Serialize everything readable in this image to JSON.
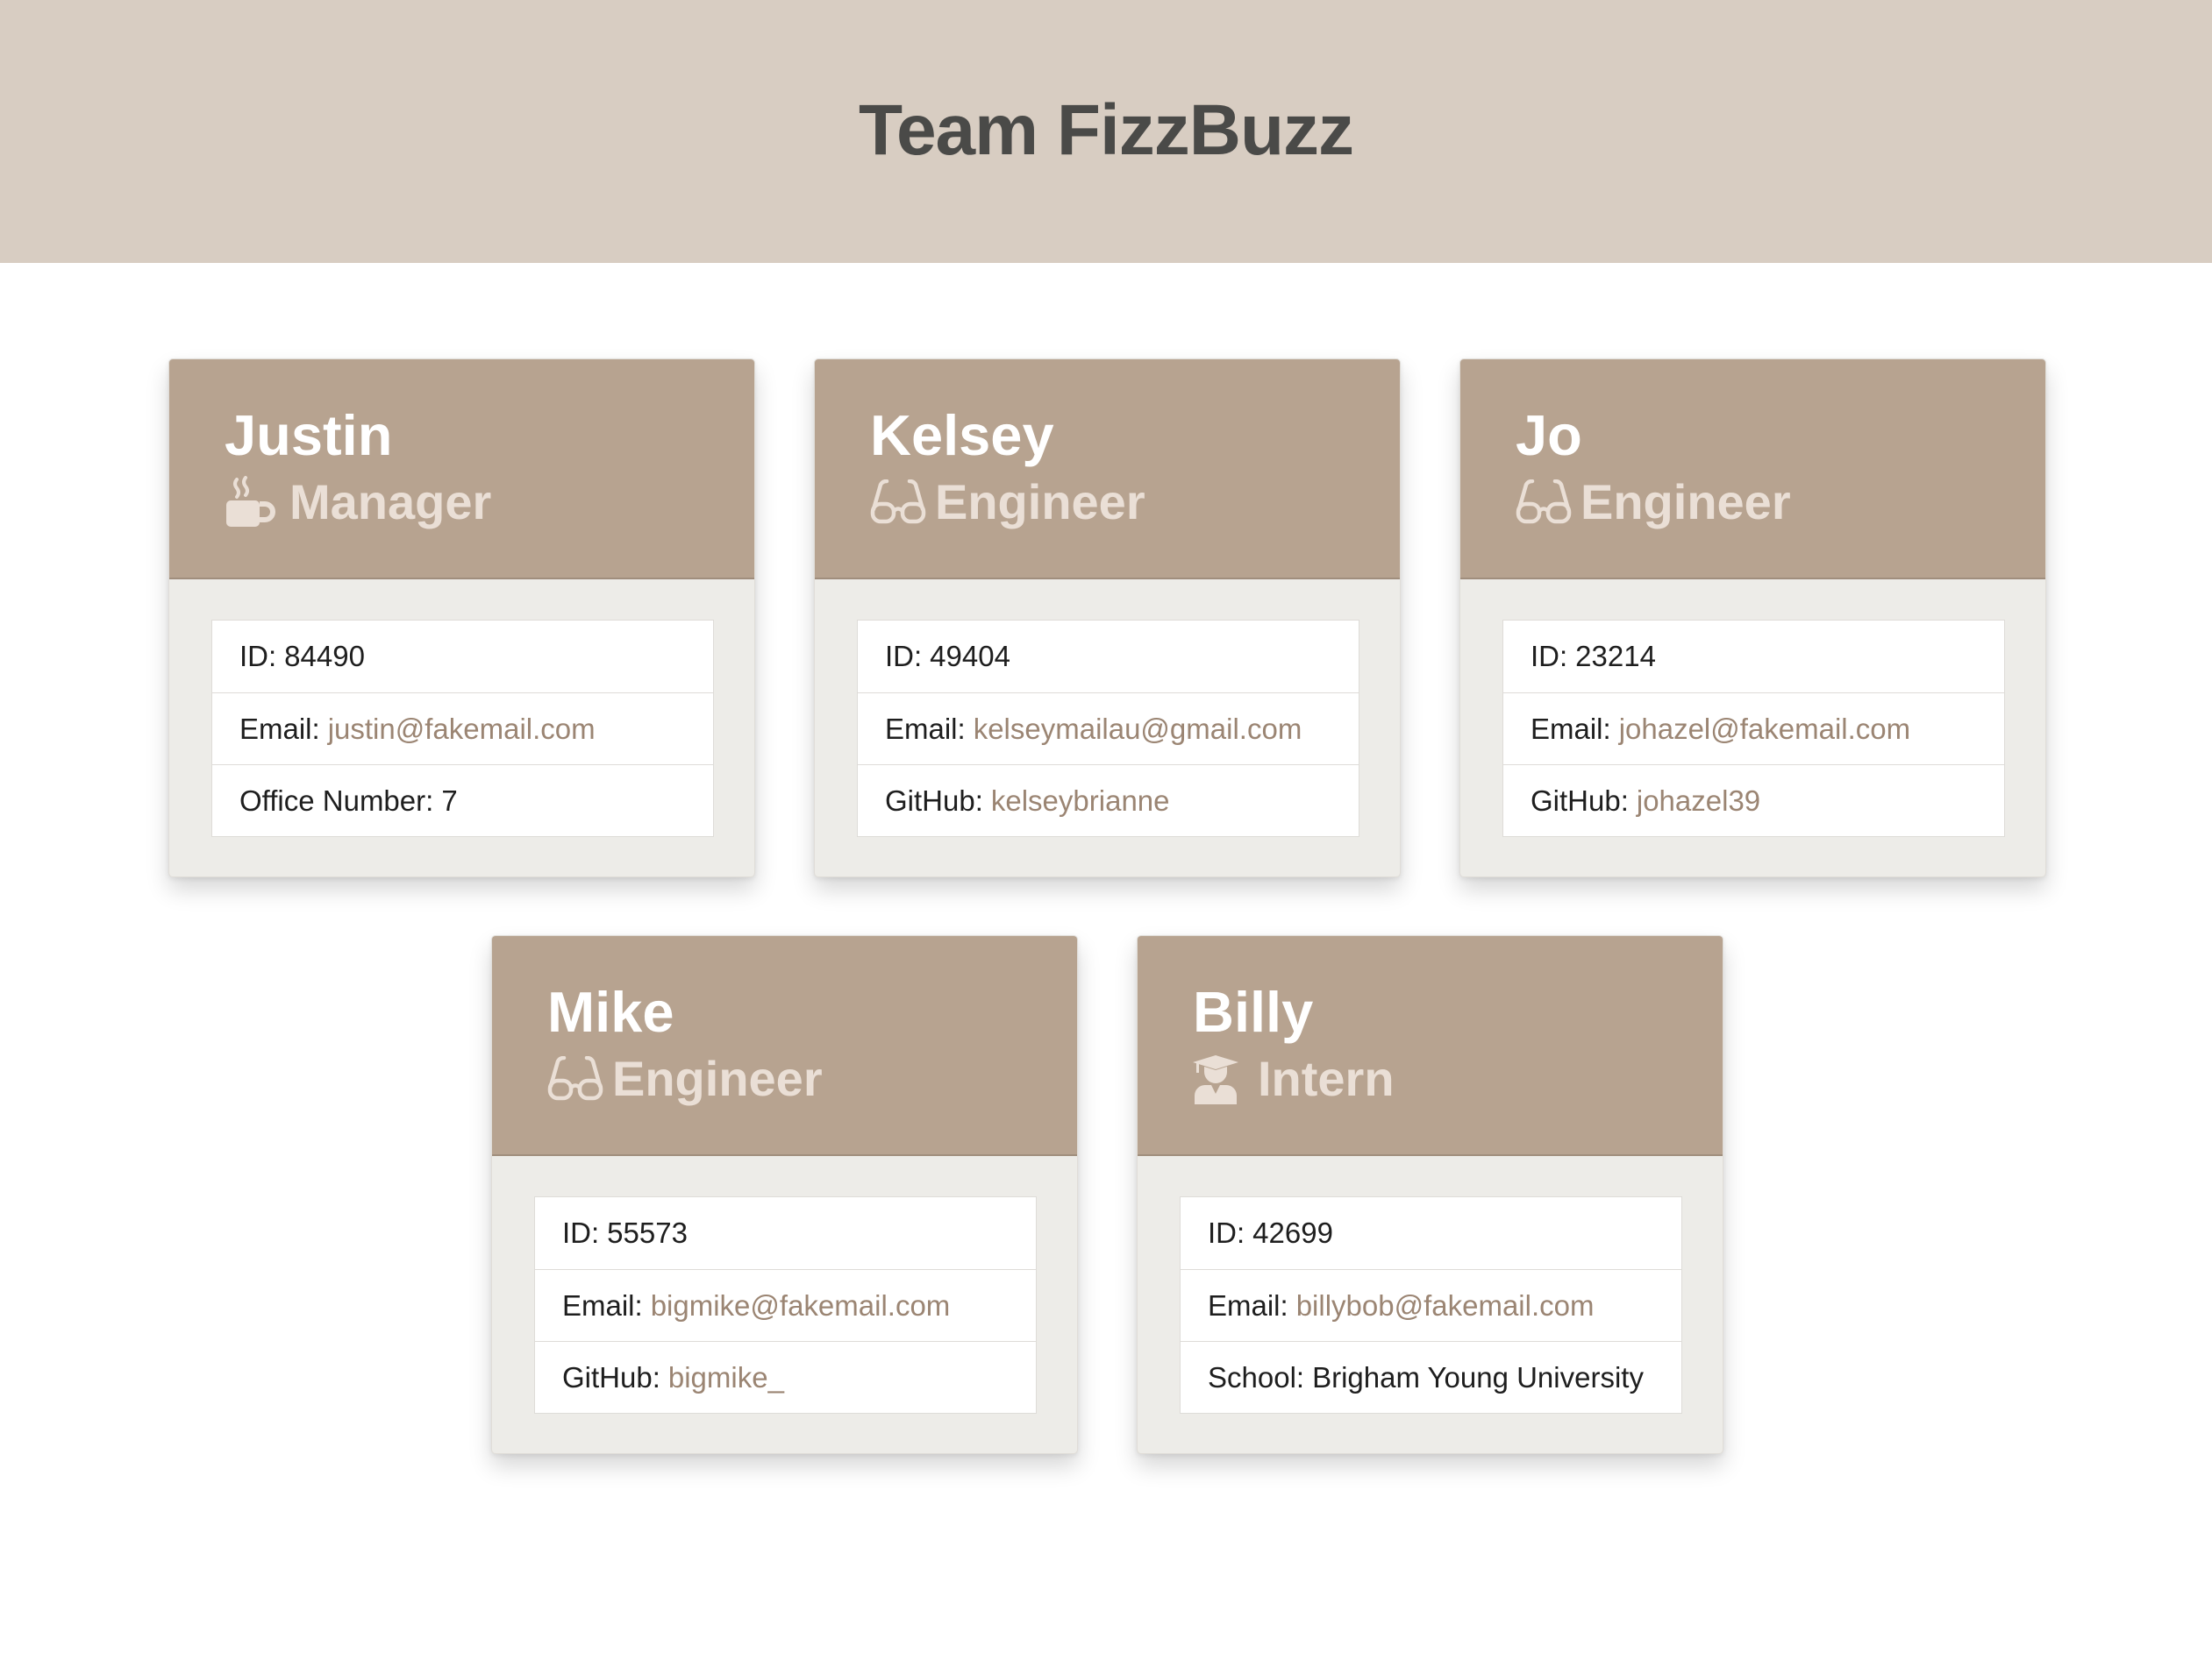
{
  "header": {
    "title": "Team FizzBuzz"
  },
  "colors": {
    "banner_bg": "#d8cdc2",
    "card_header_bg": "#b7a390",
    "card_body_bg": "#edece8",
    "link": "#9b8573"
  },
  "cards": [
    {
      "name": "Justin",
      "role": "Manager",
      "icon": "mug-icon",
      "id_label": "ID:",
      "id_value": "84490",
      "email_label": "Email:",
      "email_value": "justin@fakemail.com",
      "extra_label": "Office Number:",
      "extra_value": "7"
    },
    {
      "name": "Kelsey",
      "role": "Engineer",
      "icon": "glasses-icon",
      "id_label": "ID:",
      "id_value": "49404",
      "email_label": "Email:",
      "email_value": "kelseymailau@gmail.com",
      "extra_label": "GitHub:",
      "extra_value": "kelseybrianne"
    },
    {
      "name": "Jo",
      "role": "Engineer",
      "icon": "glasses-icon",
      "id_label": "ID:",
      "id_value": "23214",
      "email_label": "Email:",
      "email_value": "johazel@fakemail.com",
      "extra_label": "GitHub:",
      "extra_value": "johazel39"
    },
    {
      "name": "Mike",
      "role": "Engineer",
      "icon": "glasses-icon",
      "id_label": "ID:",
      "id_value": "55573",
      "email_label": "Email:",
      "email_value": "bigmike@fakemail.com",
      "extra_label": "GitHub:",
      "extra_value": "bigmike_"
    },
    {
      "name": "Billy",
      "role": "Intern",
      "icon": "graduate-icon",
      "id_label": "ID:",
      "id_value": "42699",
      "email_label": "Email:",
      "email_value": "billybob@fakemail.com",
      "extra_label": "School:",
      "extra_value": "Brigham Young University"
    }
  ]
}
